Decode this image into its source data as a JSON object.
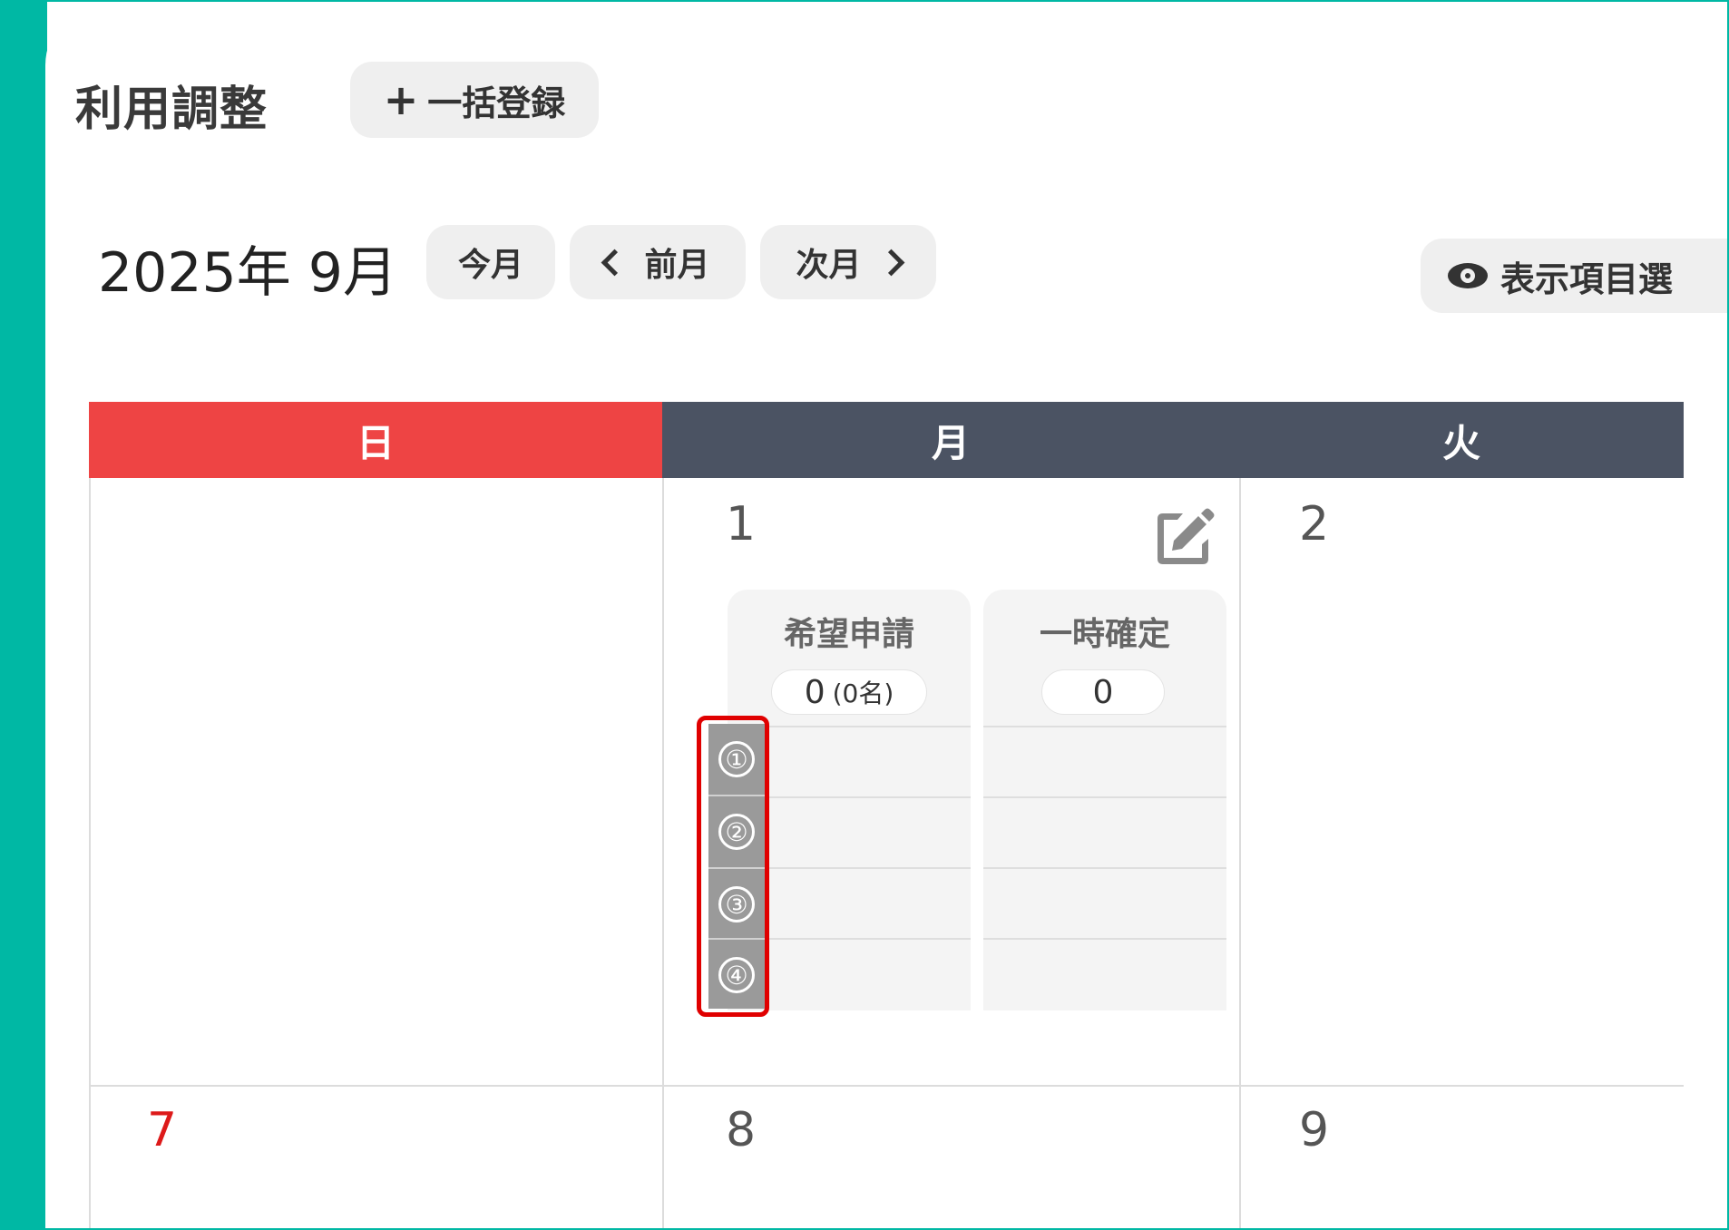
{
  "header": {
    "title": "利用調整",
    "bulk_register_label": "一括登録",
    "bulk_register_icon": "+"
  },
  "month_nav": {
    "title": "2025年 9月",
    "today_label": "今月",
    "prev_label": "前月",
    "next_label": "次月",
    "display_items_label": "表示項目選"
  },
  "calendar": {
    "weekday_headers": [
      "日",
      "月",
      "火"
    ],
    "colors": {
      "sunday_header": "#ee4444",
      "weekday_header": "#4b5363",
      "sunday_number": "#dd1a1a"
    },
    "week1": {
      "days": [
        "1",
        "2"
      ]
    },
    "week2": {
      "days": [
        "7",
        "8",
        "9"
      ]
    },
    "day1": {
      "columns": [
        {
          "title": "希望申請",
          "count": "0",
          "count_sub": "(0名)"
        },
        {
          "title": "一時確定",
          "count": "0"
        }
      ],
      "slot_labels": [
        "①",
        "②",
        "③",
        "④"
      ]
    }
  }
}
